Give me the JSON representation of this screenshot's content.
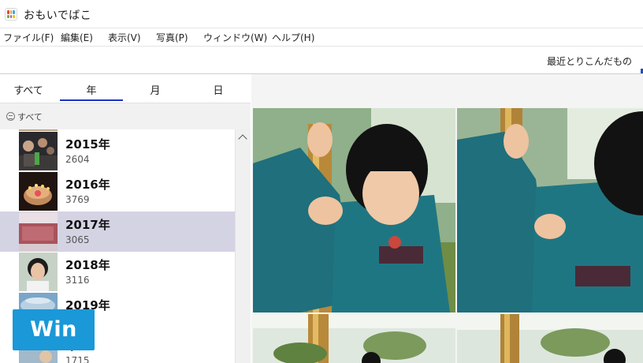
{
  "window": {
    "title": "おもいでばこ"
  },
  "menu": {
    "items": [
      "ファイル(F)",
      "編集(E)",
      "表示(V)",
      "写真(P)",
      "ウィンドウ(W)",
      "ヘルプ(H)"
    ]
  },
  "toolbar": {
    "recent_tab": "最近とりこんだもの"
  },
  "sidebar": {
    "tabs": [
      "すべて",
      "年",
      "月",
      "日"
    ],
    "active_tab": "年",
    "filter_label": "すべて",
    "years": [
      {
        "year": "2015年",
        "count": "2604"
      },
      {
        "year": "2016年",
        "count": "3769"
      },
      {
        "year": "2017年",
        "count": "3065"
      },
      {
        "year": "2018年",
        "count": "3116"
      },
      {
        "year": "2019年",
        "count": ""
      },
      {
        "year": "年",
        "count": "1715"
      }
    ],
    "selected_year": "2017年"
  },
  "badge": {
    "label": "Win"
  },
  "colors": {
    "accent": "#1c33c8",
    "selected_row": "#d3d3e4",
    "badge": "#1a98d8"
  }
}
